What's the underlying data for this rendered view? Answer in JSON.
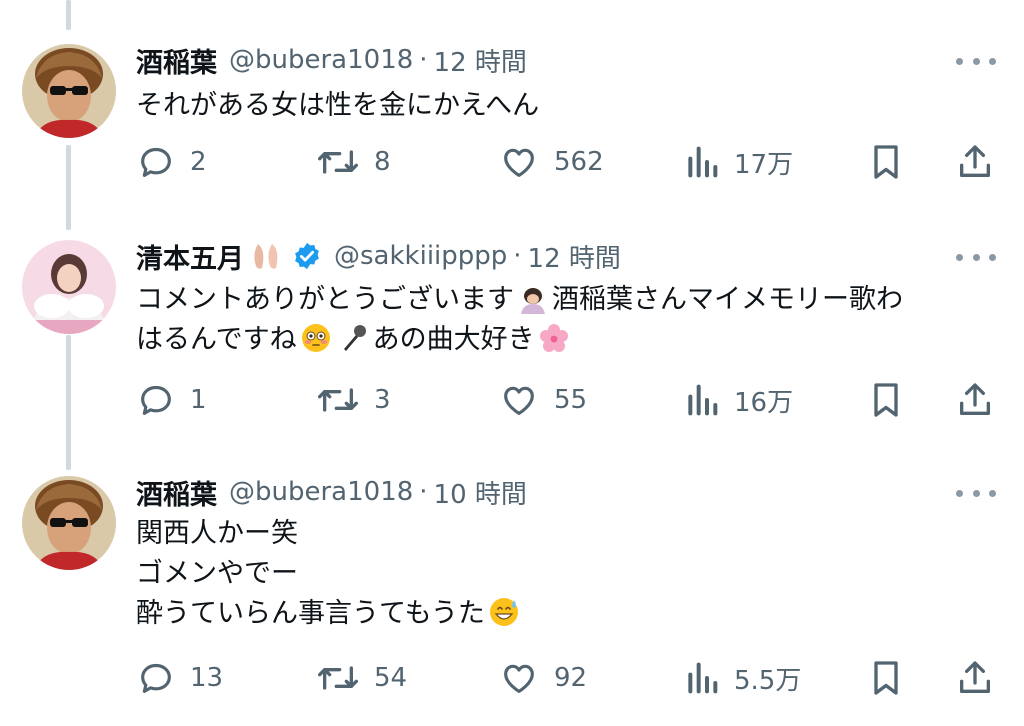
{
  "tweets": [
    {
      "name": "酒稲葉",
      "handle": "@bubera1018",
      "sep": "·",
      "time": "12 時間",
      "lines": [
        "それがある女は性を金にかえへん"
      ],
      "replies": "2",
      "retweets": "8",
      "likes": "562",
      "views": "17万"
    },
    {
      "name": "清本五月",
      "handle": "@sakkiiipppp",
      "sep": "·",
      "time": "12 時間",
      "line1a": "コメントありがとうございます",
      "line1b": "酒稲葉さんマイメモリー歌わ",
      "line2a": "はるんですね",
      "line2b": "あの曲大好き",
      "replies": "1",
      "retweets": "3",
      "likes": "55",
      "views": "16万"
    },
    {
      "name": "酒稲葉",
      "handle": "@bubera1018",
      "sep": "·",
      "time": "10 時間",
      "line1": "関西人かー笑",
      "line2": "ゴメンやでー",
      "line3a": "酔うていらん事言うてもうた",
      "replies": "13",
      "retweets": "54",
      "likes": "92",
      "views": "5.5万"
    }
  ],
  "icons": {
    "reply": "reply-icon",
    "retweet": "retweet-icon",
    "like": "like-icon",
    "views": "views-icon",
    "bookmark": "bookmark-icon",
    "share": "share-icon"
  },
  "colors": {
    "text": "#0f1419",
    "muted": "#536471",
    "verified": "#1d9bf0",
    "thread": "#cfd9de"
  }
}
